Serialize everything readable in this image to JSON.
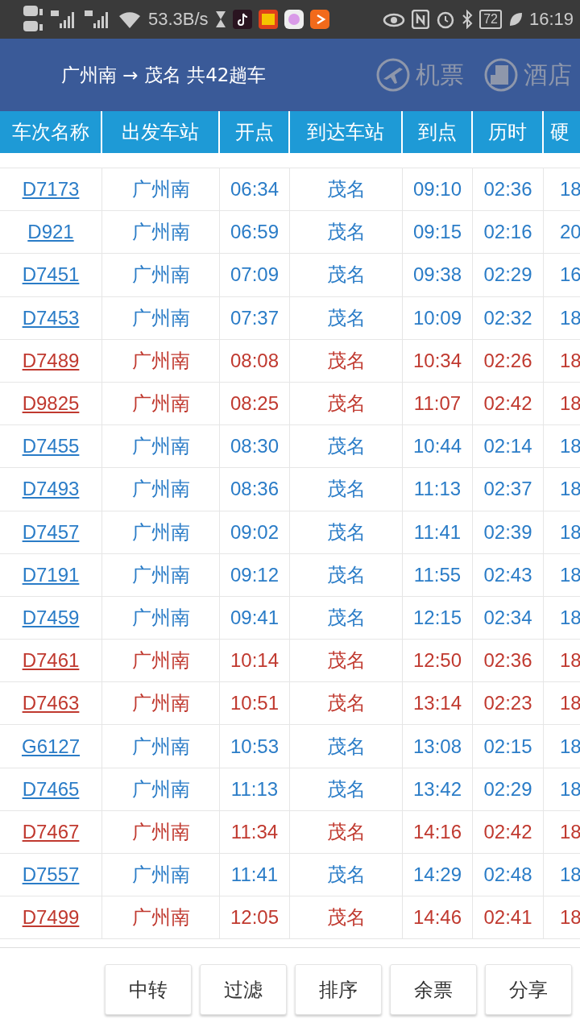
{
  "status_bar": {
    "speed": "53.3B/s",
    "battery": "72",
    "time": "16:19"
  },
  "header": {
    "title": "广州南 → 茂名 共42趟车",
    "links": [
      "机票",
      "酒店"
    ]
  },
  "table": {
    "columns": [
      "车次名称",
      "出发车站",
      "开点",
      "到达车站",
      "到点",
      "历时",
      "硬"
    ],
    "rows": [
      {
        "train": "D7173",
        "from": "广州南",
        "dep": "06:34",
        "to": "茂名",
        "arr": "09:10",
        "dur": "02:36",
        "column_7": "18",
        "color": "#2a7cc7"
      },
      {
        "train": "D921",
        "from": "广州南",
        "dep": "06:59",
        "to": "茂名",
        "arr": "09:15",
        "dur": "02:16",
        "column_7": "20",
        "color": "#2a7cc7"
      },
      {
        "train": "D7451",
        "from": "广州南",
        "dep": "07:09",
        "to": "茂名",
        "arr": "09:38",
        "dur": "02:29",
        "column_7": "16",
        "color": "#2a7cc7"
      },
      {
        "train": "D7453",
        "from": "广州南",
        "dep": "07:37",
        "to": "茂名",
        "arr": "10:09",
        "dur": "02:32",
        "column_7": "18",
        "color": "#2a7cc7"
      },
      {
        "train": "D7489",
        "from": "广州南",
        "dep": "08:08",
        "to": "茂名",
        "arr": "10:34",
        "dur": "02:26",
        "column_7": "18",
        "color": "#c0392f"
      },
      {
        "train": "D9825",
        "from": "广州南",
        "dep": "08:25",
        "to": "茂名",
        "arr": "11:07",
        "dur": "02:42",
        "column_7": "18",
        "color": "#c0392f"
      },
      {
        "train": "D7455",
        "from": "广州南",
        "dep": "08:30",
        "to": "茂名",
        "arr": "10:44",
        "dur": "02:14",
        "column_7": "18",
        "color": "#2a7cc7"
      },
      {
        "train": "D7493",
        "from": "广州南",
        "dep": "08:36",
        "to": "茂名",
        "arr": "11:13",
        "dur": "02:37",
        "column_7": "18",
        "color": "#2a7cc7"
      },
      {
        "train": "D7457",
        "from": "广州南",
        "dep": "09:02",
        "to": "茂名",
        "arr": "11:41",
        "dur": "02:39",
        "column_7": "18",
        "color": "#2a7cc7"
      },
      {
        "train": "D7191",
        "from": "广州南",
        "dep": "09:12",
        "to": "茂名",
        "arr": "11:55",
        "dur": "02:43",
        "column_7": "18",
        "color": "#2a7cc7"
      },
      {
        "train": "D7459",
        "from": "广州南",
        "dep": "09:41",
        "to": "茂名",
        "arr": "12:15",
        "dur": "02:34",
        "column_7": "18",
        "color": "#2a7cc7"
      },
      {
        "train": "D7461",
        "from": "广州南",
        "dep": "10:14",
        "to": "茂名",
        "arr": "12:50",
        "dur": "02:36",
        "column_7": "18",
        "color": "#c0392f"
      },
      {
        "train": "D7463",
        "from": "广州南",
        "dep": "10:51",
        "to": "茂名",
        "arr": "13:14",
        "dur": "02:23",
        "column_7": "18",
        "color": "#c0392f"
      },
      {
        "train": "G6127",
        "from": "广州南",
        "dep": "10:53",
        "to": "茂名",
        "arr": "13:08",
        "dur": "02:15",
        "column_7": "18",
        "color": "#2a7cc7"
      },
      {
        "train": "D7465",
        "from": "广州南",
        "dep": "11:13",
        "to": "茂名",
        "arr": "13:42",
        "dur": "02:29",
        "column_7": "18",
        "color": "#2a7cc7"
      },
      {
        "train": "D7467",
        "from": "广州南",
        "dep": "11:34",
        "to": "茂名",
        "arr": "14:16",
        "dur": "02:42",
        "column_7": "18",
        "color": "#c0392f"
      },
      {
        "train": "D7557",
        "from": "广州南",
        "dep": "11:41",
        "to": "茂名",
        "arr": "14:29",
        "dur": "02:48",
        "column_7": "18",
        "color": "#2a7cc7"
      },
      {
        "train": "D7499",
        "from": "广州南",
        "dep": "12:05",
        "to": "茂名",
        "arr": "14:46",
        "dur": "02:41",
        "column_7": "18",
        "color": "#c0392f"
      }
    ]
  },
  "buttons": [
    "中转",
    "过滤",
    "排序",
    "余票",
    "分享"
  ]
}
